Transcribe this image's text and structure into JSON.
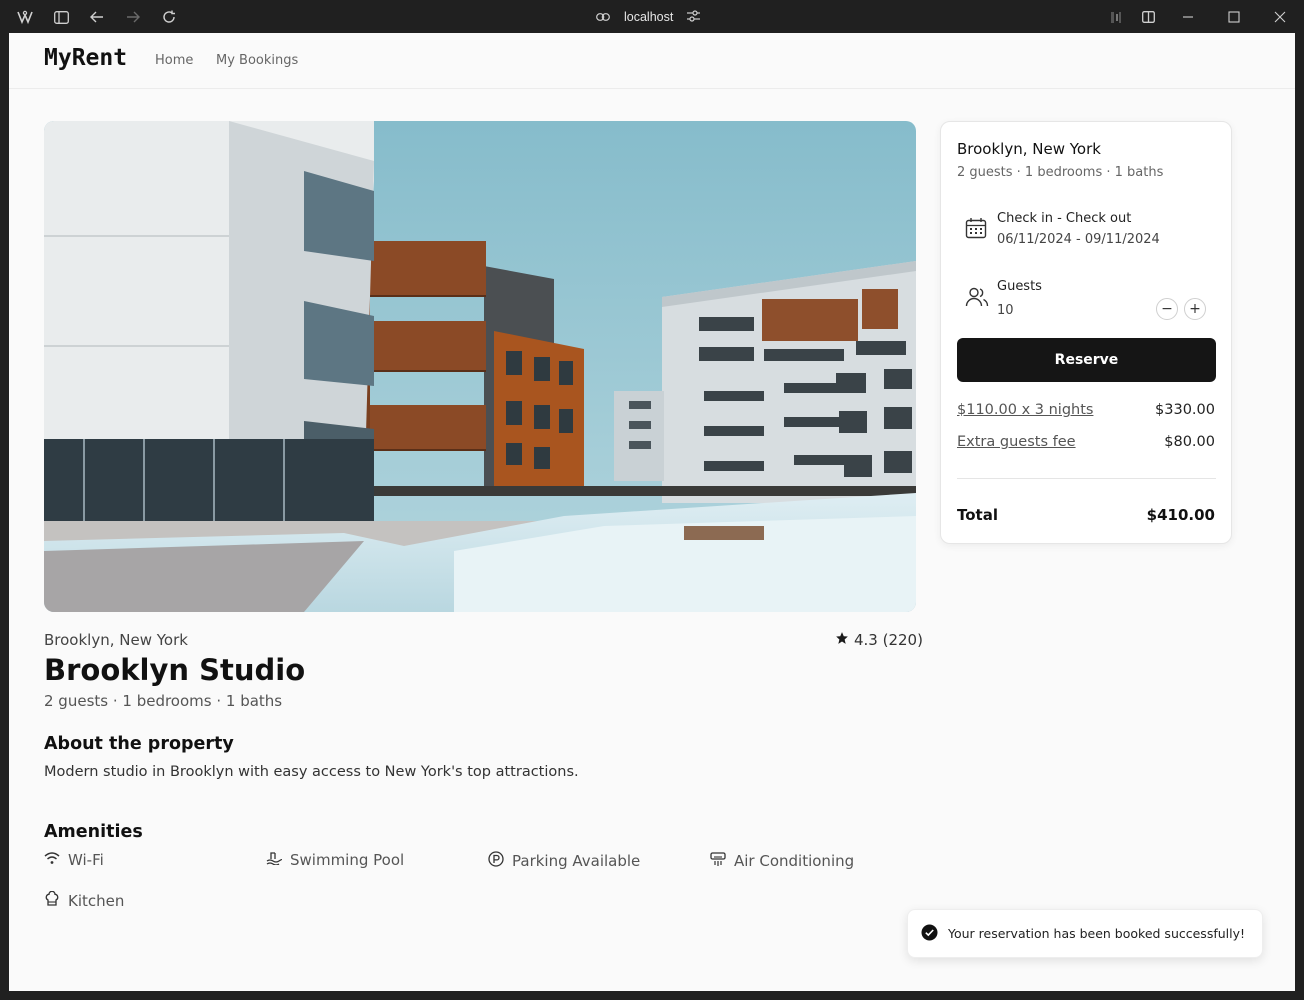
{
  "browser": {
    "url": "localhost",
    "icons": [
      "app-logo-icon",
      "sidebar-toggle-icon",
      "back-icon",
      "forward-icon",
      "reload-icon",
      "link-icon",
      "site-settings-icon",
      "extension-icon",
      "split-view-icon",
      "minimize-icon",
      "maximize-icon",
      "close-icon"
    ]
  },
  "nav": {
    "brand": "MyRent",
    "links": [
      "Home",
      "My Bookings"
    ]
  },
  "listing": {
    "location": "Brooklyn, New York",
    "rating": "4.3 (220)",
    "title": "Brooklyn Studio",
    "specs": "2 guests · 1 bedrooms · 1 baths",
    "about_heading": "About the property",
    "about_text": "Modern studio in Brooklyn with easy access to New York's top attractions.",
    "amenities_heading": "Amenities",
    "amenities": [
      {
        "label": "Wi-Fi",
        "icon": "wifi-icon"
      },
      {
        "label": "Swimming Pool",
        "icon": "pool-icon"
      },
      {
        "label": "Parking Available",
        "icon": "parking-icon"
      },
      {
        "label": "Air Conditioning",
        "icon": "air-conditioning-icon"
      },
      {
        "label": "Kitchen",
        "icon": "kitchen-icon"
      }
    ]
  },
  "booking": {
    "location": "Brooklyn, New York",
    "specs": "2 guests · 1 bedrooms · 1 baths",
    "dates_label": "Check in - Check out",
    "dates_value": "06/11/2024 - 09/11/2024",
    "guests_label": "Guests",
    "guests_value": "10",
    "decrement": "−",
    "increment": "+",
    "reserve_label": "Reserve",
    "nightly_label": "$110.00 x 3 nights",
    "nightly_amount": "$330.00",
    "extra_label": "Extra guests fee",
    "extra_amount": "$80.00",
    "total_label": "Total",
    "total_amount": "$410.00"
  },
  "toast": {
    "message": "Your reservation has been booked successfully!"
  },
  "colors": {
    "primary_button": "#151515",
    "page_bg": "#fafafa",
    "chrome_bg": "#202020"
  }
}
